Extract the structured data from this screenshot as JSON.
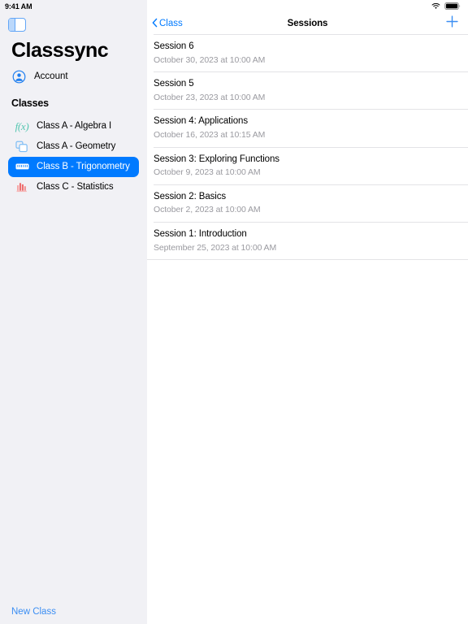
{
  "status_bar": {
    "time": "9:41 AM",
    "wifi_icon": "wifi-icon",
    "battery_icon": "battery-icon"
  },
  "sidebar": {
    "toggle_icon": "sidebar-toggle-icon",
    "app_title": "Classsync",
    "account": {
      "icon": "account-circle-icon",
      "label": "Account"
    },
    "section_header": "Classes",
    "items": [
      {
        "label": "Class A - Algebra I",
        "icon": "function-fx-icon",
        "icon_glyph": "f(x)",
        "selected": false
      },
      {
        "label": "Class A - Geometry",
        "icon": "shapes-squares-icon",
        "icon_glyph": "",
        "selected": false
      },
      {
        "label": "Class B - Trigonometry",
        "icon": "ruler-icon",
        "icon_glyph": "",
        "selected": true
      },
      {
        "label": "Class C - Statistics",
        "icon": "bar-chart-icon",
        "icon_glyph": "",
        "selected": false
      }
    ],
    "new_class_label": "New Class"
  },
  "detail": {
    "back_label": "Class",
    "back_icon": "chevron-left-icon",
    "title": "Sessions",
    "add_icon": "plus-icon",
    "sessions": [
      {
        "title": "Session 6",
        "subtitle": "October 30, 2023 at 10:00 AM"
      },
      {
        "title": "Session 5",
        "subtitle": "October 23, 2023 at 10:00 AM"
      },
      {
        "title": "Session 4: Applications",
        "subtitle": "October 16, 2023 at 10:15 AM"
      },
      {
        "title": "Session 3: Exploring Functions",
        "subtitle": "October 9, 2023 at 10:00 AM"
      },
      {
        "title": "Session 2: Basics",
        "subtitle": "October 2, 2023 at 10:00 AM"
      },
      {
        "title": "Session 1: Introduction",
        "subtitle": "September 25, 2023 at 10:00 AM"
      }
    ]
  },
  "colors": {
    "accent": "#007AFF",
    "sidebar_bg": "#F1F1F5",
    "selected_row_bg": "#007AFF",
    "separator": "#E3E3E6",
    "subtitle_text": "#9A9AA0",
    "link_blue": "#3B8EF3",
    "algebra_icon": "#54C6B0",
    "geometry_icon": "#7EBDF5",
    "statistics_icon": "#F07A7A"
  }
}
